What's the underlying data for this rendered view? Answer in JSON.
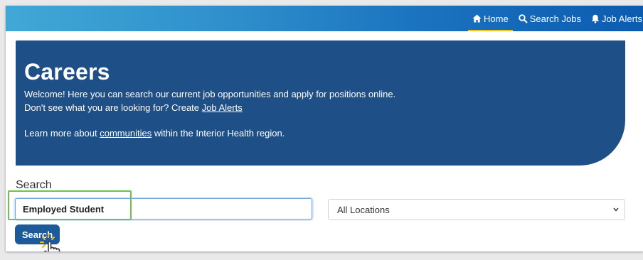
{
  "nav": {
    "items": [
      {
        "label": "Home",
        "icon": "home-icon",
        "active": true
      },
      {
        "label": "Search Jobs",
        "icon": "search-icon",
        "active": false
      },
      {
        "label": "Job Alerts",
        "icon": "bell-icon",
        "active": false
      }
    ]
  },
  "hero": {
    "title": "Careers",
    "line1": "Welcome! Here you can search our current job opportunities and apply for positions online.",
    "line2_prefix": "Don't see what you are looking for? Create ",
    "line2_link": "Job Alerts",
    "line3_prefix": "Learn more about ",
    "line3_link": "communities",
    "line3_suffix": " within the Interior Health region."
  },
  "search": {
    "label": "Search",
    "input_value": "Employed Student",
    "location_selected": "All Locations",
    "button_label": "Search"
  },
  "colors": {
    "hero_bg": "#1e4f86",
    "button_bg": "#1c5a99",
    "highlight": "#6cc24a",
    "nav_active_underline": "#f3c324"
  }
}
